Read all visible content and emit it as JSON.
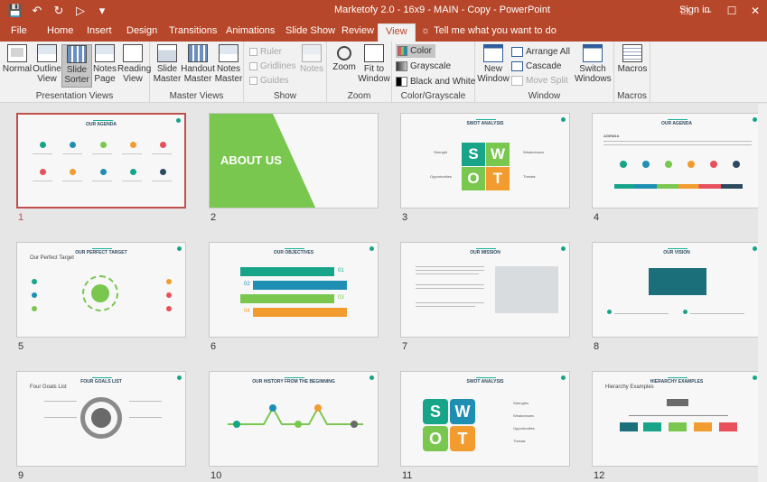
{
  "window": {
    "title": "Marketofy 2.0 - 16x9 - MAIN - Copy  -  PowerPoint",
    "signin": "Sign in"
  },
  "tabs": [
    "File",
    "Home",
    "Insert",
    "Design",
    "Transitions",
    "Animations",
    "Slide Show",
    "Review",
    "View"
  ],
  "active_tab": "View",
  "tell_me": "Tell me what you want to do",
  "ribbon": {
    "presentation_views": {
      "label": "Presentation Views",
      "buttons": [
        "Normal",
        "Outline View",
        "Slide Sorter",
        "Notes Page",
        "Reading View"
      ],
      "selected": "Slide Sorter"
    },
    "master_views": {
      "label": "Master Views",
      "buttons": [
        "Slide Master",
        "Handout Master",
        "Notes Master"
      ]
    },
    "show": {
      "label": "Show",
      "checks": [
        "Ruler",
        "Gridlines",
        "Guides"
      ],
      "notes": "Notes"
    },
    "zoom": {
      "label": "Zoom",
      "buttons": [
        "Zoom",
        "Fit to Window"
      ]
    },
    "color": {
      "label": "Color/Grayscale",
      "options": [
        "Color",
        "Grayscale",
        "Black and White"
      ]
    },
    "window": {
      "label": "Window",
      "new_window": "New Window",
      "small": [
        "Arrange All",
        "Cascade",
        "Move Split"
      ],
      "switch": "Switch Windows"
    },
    "macros": {
      "label": "Macros",
      "button": "Macros"
    }
  },
  "colors": {
    "accent": "#b7472a",
    "teal": "#17a489",
    "green": "#7ac74f",
    "orange": "#f29b2f",
    "red": "#e8505b",
    "blue": "#1e8fb3",
    "dark": "#2e4a5f"
  },
  "slides": [
    {
      "n": "1",
      "title": "OUR AGENDA"
    },
    {
      "n": "2",
      "title": "ABOUT US"
    },
    {
      "n": "3",
      "title": "SWOT ANALYSIS",
      "labels": [
        "Strength",
        "Weaknesses",
        "Opportunities",
        "Threats"
      ]
    },
    {
      "n": "4",
      "title": "OUR AGENDA",
      "subtitle": "AGENDA"
    },
    {
      "n": "5",
      "title": "OUR PERFECT TARGET",
      "side": "Our Perfect Target"
    },
    {
      "n": "6",
      "title": "OUR OBJECTIVES",
      "items": [
        "01",
        "02",
        "03",
        "04"
      ]
    },
    {
      "n": "7",
      "title": "OUR MISSION"
    },
    {
      "n": "8",
      "title": "OUR VISION"
    },
    {
      "n": "9",
      "title": "FOUR GOALS LIST",
      "side": "Four Goals List"
    },
    {
      "n": "10",
      "title": "OUR HISTORY FROM THE BEGINNING"
    },
    {
      "n": "11",
      "title": "SWOT ANALYSIS",
      "labels": [
        "Strengths",
        "Weaknesses",
        "Opportunities",
        "Threats"
      ]
    },
    {
      "n": "12",
      "title": "HIERARCHY EXAMPLES",
      "side": "Hierarchy Examples"
    }
  ],
  "swot_letters": [
    "S",
    "W",
    "O",
    "T"
  ]
}
